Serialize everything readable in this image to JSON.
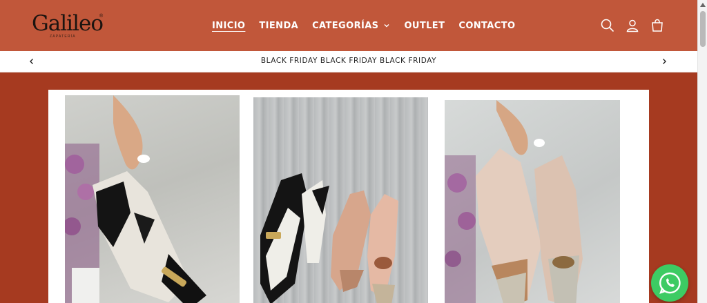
{
  "brand": {
    "name": "Galileo",
    "mark": "®",
    "tagline": "ZAPATERÍA"
  },
  "nav": {
    "items": [
      {
        "label": "INICIO",
        "active": true
      },
      {
        "label": "TIENDA"
      },
      {
        "label": "CATEGORÍAS",
        "has_dropdown": true
      },
      {
        "label": "OUTLET"
      },
      {
        "label": "CONTACTO"
      }
    ]
  },
  "header_icons": [
    "search-icon",
    "account-icon",
    "cart-icon"
  ],
  "announcement": {
    "text": "BLACK FRIDAY BLACK FRIDAY BLACK FRIDAY"
  },
  "hero": {
    "photos": [
      {
        "subject": "hand holding black and white slingback heels"
      },
      {
        "subject": "two pairs of heels on wooden floor"
      },
      {
        "subject": "hand holding nude and silver slingback heels"
      }
    ]
  },
  "colors": {
    "header": "#c1573a",
    "hero_background": "#a63a20",
    "whatsapp": "#3dcb63"
  },
  "whatsapp_label": "WhatsApp"
}
